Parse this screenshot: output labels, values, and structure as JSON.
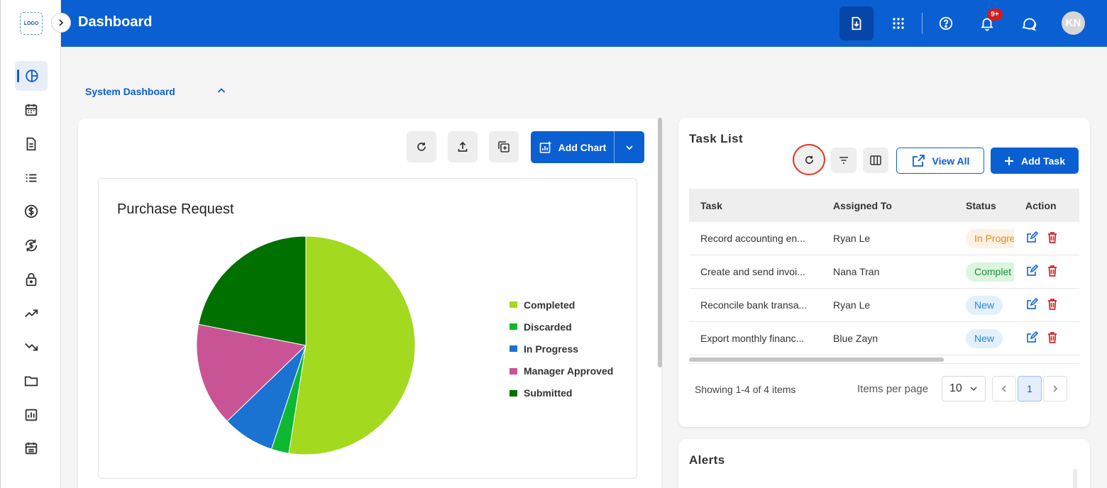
{
  "app": {
    "logo_text": "LOGO",
    "header_title": "Dashboard",
    "user_initials": "KN",
    "notification_count": "9+",
    "header_icons": [
      "download-file-icon",
      "apps-grid-icon",
      "help-icon",
      "bell-icon",
      "chat-icon"
    ]
  },
  "sidebar": {
    "items": [
      {
        "icon": "dashboard-pie-icon",
        "active": true
      },
      {
        "icon": "calendar-icon"
      },
      {
        "icon": "document-icon"
      },
      {
        "icon": "list-icon"
      },
      {
        "icon": "dollar-circle-icon"
      },
      {
        "icon": "dollar-cycle-icon"
      },
      {
        "icon": "lock-icon"
      },
      {
        "icon": "trending-up-icon"
      },
      {
        "icon": "trending-down-icon"
      },
      {
        "icon": "folder-icon"
      },
      {
        "icon": "bar-chart-icon"
      },
      {
        "icon": "calendar-list-icon"
      }
    ]
  },
  "section": {
    "title": "System Dashboard"
  },
  "chart_panel": {
    "add_chart_label": "Add Chart",
    "toolbar_icons": [
      "refresh-icon",
      "upload-icon",
      "duplicate-icon"
    ]
  },
  "chart_data": {
    "type": "pie",
    "title": "Purchase Request",
    "legend_position": "right",
    "series": [
      {
        "name": "Completed",
        "value": 52.5,
        "color": "#a3d91e"
      },
      {
        "name": "Discarded",
        "value": 2.6,
        "color": "#0db832"
      },
      {
        "name": "In Progress",
        "value": 7.7,
        "color": "#1a73d1"
      },
      {
        "name": "Manager Approved",
        "value": 15.3,
        "color": "#c95495"
      },
      {
        "name": "Submitted",
        "value": 21.9,
        "color": "#007000"
      }
    ]
  },
  "task_list": {
    "title": "Task List",
    "view_all_label": "View All",
    "add_task_label": "Add Task",
    "columns": [
      "Task",
      "Assigned To",
      "Status",
      "Action"
    ],
    "rows": [
      {
        "task": "Record accounting en...",
        "assigned": "Ryan Le",
        "status": "In Progre",
        "status_bg": "#fdf1e4",
        "status_color": "#e08a1e"
      },
      {
        "task": "Create and send invoi...",
        "assigned": "Nana Tran",
        "status": "Complet",
        "status_bg": "#dcf5df",
        "status_color": "#1e8f36"
      },
      {
        "task": "Reconcile bank transa...",
        "assigned": "Ryan Le",
        "status": "New",
        "status_bg": "#e2f0fb",
        "status_color": "#2a86d0"
      },
      {
        "task": "Export monthly financ...",
        "assigned": "Blue Zayn",
        "status": "New",
        "status_bg": "#e2f0fb",
        "status_color": "#2a86d0"
      }
    ],
    "footer": {
      "showing": "Showing 1-4 of 4 items",
      "items_per_page_label": "Items per page",
      "items_per_page_value": "10",
      "current_page": "1"
    }
  },
  "alerts": {
    "title": "Alerts"
  },
  "colors": {
    "primary": "#0a5fd3",
    "header_bg": "#0a5fd3",
    "danger": "#d21d1d"
  }
}
